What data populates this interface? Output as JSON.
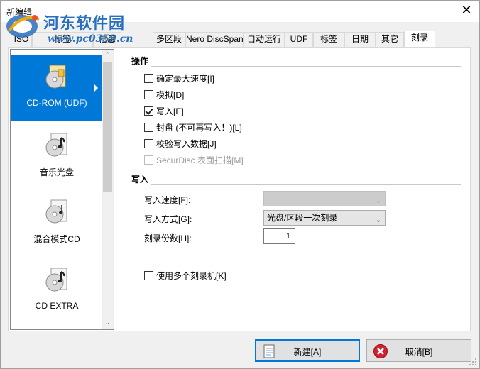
{
  "window": {
    "title": "新编辑",
    "close_glyph": "✕"
  },
  "watermark": {
    "site_name": "河东软件园",
    "url": "www.pc0359.cn"
  },
  "tabs": [
    {
      "label": "ISO"
    },
    {
      "label": "标签"
    },
    {
      "label": "信息"
    },
    {
      "label": "多区段"
    },
    {
      "label": "Nero DiscSpan"
    },
    {
      "label": "自动运行"
    },
    {
      "label": "UDF"
    },
    {
      "label": "标签"
    },
    {
      "label": "日期"
    },
    {
      "label": "其它"
    },
    {
      "label": "刻录",
      "active": true
    }
  ],
  "sidebar": {
    "items": [
      {
        "label": "CD-ROM (UDF)",
        "icon": "cd-rom-udf-icon",
        "selected": true
      },
      {
        "label": "音乐光盘",
        "icon": "music-disc-icon"
      },
      {
        "label": "混合模式CD",
        "icon": "mixed-mode-cd-icon"
      },
      {
        "label": "CD EXTRA",
        "icon": "cd-extra-icon"
      }
    ],
    "scroll_up_glyph": "⌃",
    "scroll_down_glyph": "⌄"
  },
  "operations": {
    "title": "操作",
    "options": [
      {
        "label": "确定最大速度[I]",
        "checked": false,
        "enabled": true
      },
      {
        "label": "模拟[D]",
        "checked": false,
        "enabled": true
      },
      {
        "label": "写入[E]",
        "checked": true,
        "enabled": true
      },
      {
        "label": "封盘 (不可再写入！)[L]",
        "checked": false,
        "enabled": true
      },
      {
        "label": "校验写入数据[J]",
        "checked": false,
        "enabled": true
      },
      {
        "label": "SecurDisc 表面扫描[M]",
        "checked": false,
        "enabled": false
      }
    ]
  },
  "write": {
    "title": "写入",
    "speed_label": "写入速度[F]:",
    "speed_value": "",
    "method_label": "写入方式[G]:",
    "method_value": "光盘/区段一次刻录",
    "copies_label": "刻录份数[H]:",
    "copies_value": "1",
    "multi_recorder_label": "使用多个刻录机[K]",
    "multi_recorder_checked": false
  },
  "buttons": {
    "new_label": "新建[A]",
    "cancel_label": "取消[B]"
  },
  "colors": {
    "selection": "#0078d7",
    "window_bg": "#f0f0f0",
    "cancel_icon": "#d2202f"
  }
}
